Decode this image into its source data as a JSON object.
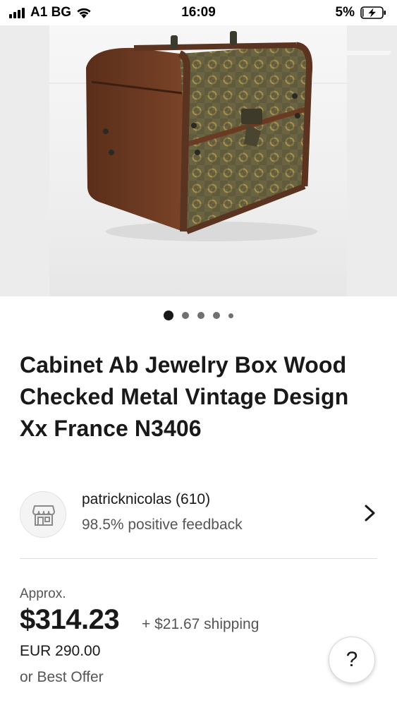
{
  "status_bar": {
    "carrier": "A1 BG",
    "time": "16:09",
    "battery_percent": "5%",
    "battery_level": 0.05,
    "signal_bars": 4,
    "icons": [
      "signal-icon",
      "wifi-icon",
      "battery-charging-icon"
    ]
  },
  "gallery": {
    "image_subject": "vintage wooden jewelry box with checked metal pattern and brass latch",
    "dot_count": 5,
    "active_dot": 0
  },
  "listing": {
    "title": "Cabinet Ab Jewelry Box Wood Checked Metal Vintage Design Xx France N3406"
  },
  "seller": {
    "name": "patricknicolas (610)",
    "feedback": "98.5% positive feedback",
    "avatar_icon": "store-icon",
    "chevron_icon": "chevron-right-icon"
  },
  "price": {
    "approx_label": "Approx.",
    "amount": "$314.23",
    "shipping": "+ $21.67 shipping",
    "original": "EUR 290.00",
    "best_offer": "or Best Offer"
  },
  "help": {
    "label": "?"
  },
  "colors": {
    "text_primary": "#191919",
    "text_secondary": "#555555",
    "divider": "#dedede",
    "image_bg": "#ececec"
  }
}
